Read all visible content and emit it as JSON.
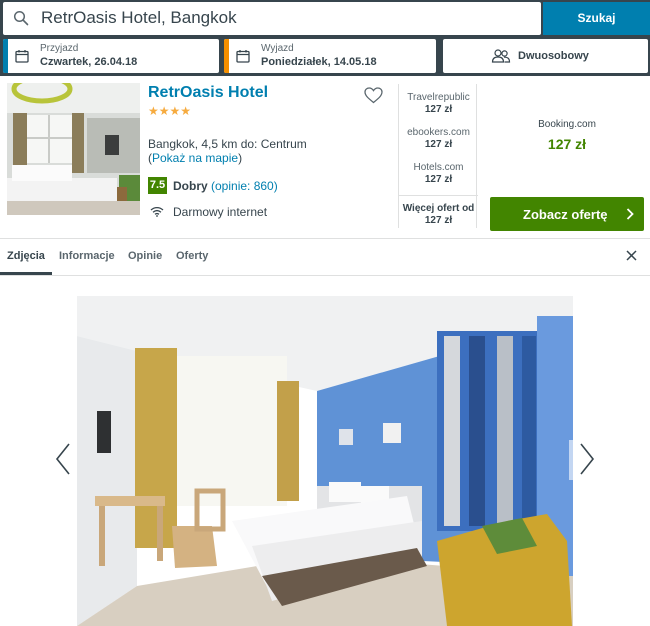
{
  "search": {
    "query": "RetrOasis Hotel, Bangkok",
    "button_label": "Szukaj",
    "icon": "search-icon"
  },
  "dates": {
    "checkin": {
      "label": "Przyjazd",
      "value": "Czwartek, 26.04.18",
      "accent": "#007faf"
    },
    "checkout": {
      "label": "Wyjazd",
      "value": "Poniedziałek, 14.05.18",
      "accent": "#f48f00"
    }
  },
  "room": {
    "value": "Dwuosobowy",
    "icon": "people-icon"
  },
  "hotel": {
    "name": "RetrOasis Hotel",
    "stars": "★★★★",
    "star_count": 4,
    "location": "Bangkok, 4,5 km do: Centrum",
    "map_link": "Pokaż na mapie",
    "rating_score": "7.5",
    "rating_label": "Dobry",
    "rating_count": "(opinie: 860)",
    "amenity": "Darmowy internet",
    "deals": [
      {
        "site": "Travelrepublic",
        "price": "127 zł"
      },
      {
        "site": "ebookers.com",
        "price": "127 zł"
      },
      {
        "site": "Hotels.com",
        "price": "127 zł"
      }
    ],
    "more_offers": {
      "label": "Więcej ofert od",
      "price": "127 zł"
    },
    "best_deal": {
      "site": "Booking.com",
      "price": "127 zł"
    },
    "view_button": "Zobacz ofertę"
  },
  "tabs": [
    {
      "label": "Zdjęcia",
      "active": true
    },
    {
      "label": "Informacje",
      "active": false
    },
    {
      "label": "Opinie",
      "active": false
    },
    {
      "label": "Oferty",
      "active": false
    }
  ],
  "colors": {
    "header_bg": "#37454d",
    "primary_blue": "#007faf",
    "deal_green": "#428500",
    "star_orange": "#f6ab3f"
  }
}
